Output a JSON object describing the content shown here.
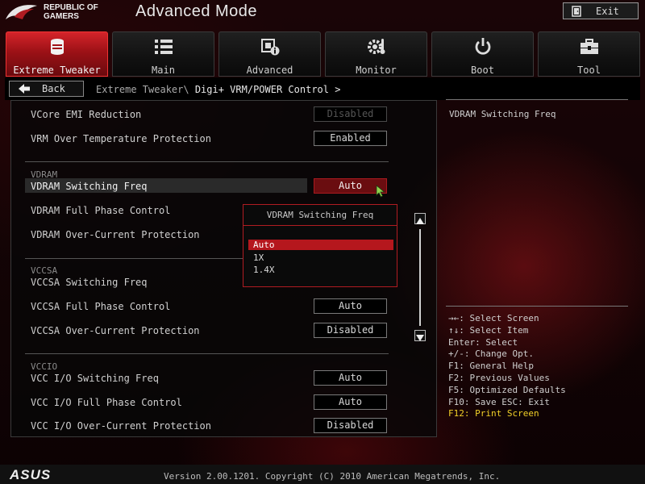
{
  "header": {
    "brand_line1": "REPUBLIC OF",
    "brand_line2": "GAMERS",
    "title": "Advanced Mode",
    "exit_label": "Exit"
  },
  "tabs": [
    {
      "label": "Extreme Tweaker",
      "icon": "tweaker-icon",
      "active": true
    },
    {
      "label": "Main",
      "icon": "list-icon",
      "active": false
    },
    {
      "label": "Advanced",
      "icon": "chip-info-icon",
      "active": false
    },
    {
      "label": "Monitor",
      "icon": "gear-thermometer-icon",
      "active": false
    },
    {
      "label": "Boot",
      "icon": "power-icon",
      "active": false
    },
    {
      "label": "Tool",
      "icon": "toolbox-icon",
      "active": false
    }
  ],
  "nav": {
    "back_label": "Back",
    "breadcrumb_parent": "Extreme Tweaker\\",
    "breadcrumb_current": "Digi+ VRM/POWER Control >"
  },
  "settings": {
    "vcore_emi": {
      "label": "VCore EMI Reduction",
      "value": "Disabled"
    },
    "vrm_otp": {
      "label": "VRM Over Temperature Protection",
      "value": "Enabled"
    },
    "vdram_section": "VDRAM",
    "vdram_freq": {
      "label": "VDRAM Switching Freq",
      "value": "Auto"
    },
    "vdram_phase": {
      "label": "VDRAM Full Phase Control"
    },
    "vdram_ocp": {
      "label": "VDRAM Over-Current Protection"
    },
    "vccsa_section": "VCCSA",
    "vccsa_freq": {
      "label": "VCCSA Switching Freq"
    },
    "vccsa_phase": {
      "label": "VCCSA Full Phase Control",
      "value": "Auto"
    },
    "vccsa_ocp": {
      "label": "VCCSA Over-Current Protection",
      "value": "Disabled"
    },
    "vccio_section": "VCCIO",
    "vccio_freq": {
      "label": "VCC I/O Switching Freq",
      "value": "Auto"
    },
    "vccio_phase": {
      "label": "VCC I/O Full Phase Control",
      "value": "Auto"
    },
    "vccio_ocp": {
      "label": "VCC I/O Over-Current Protection",
      "value": "Disabled"
    }
  },
  "dropdown": {
    "title": "VDRAM Switching Freq",
    "options": [
      "Auto",
      "1X",
      "1.4X"
    ],
    "selected": "Auto"
  },
  "help": {
    "title": "VDRAM Switching Freq",
    "keys": [
      "→←: Select Screen",
      "↑↓: Select Item",
      "Enter: Select",
      "+/-: Change Opt.",
      "F1: General Help",
      "F2: Previous Values",
      "F5: Optimized Defaults",
      "F10: Save  ESC: Exit"
    ],
    "highlight_key": "F12: Print Screen"
  },
  "footer": {
    "logo": "ASUS",
    "version": "Version 2.00.1201. Copyright (C) 2010 American Megatrends, Inc."
  },
  "colors": {
    "accent_red": "#b5171d",
    "highlight_yellow": "#f2d028"
  }
}
